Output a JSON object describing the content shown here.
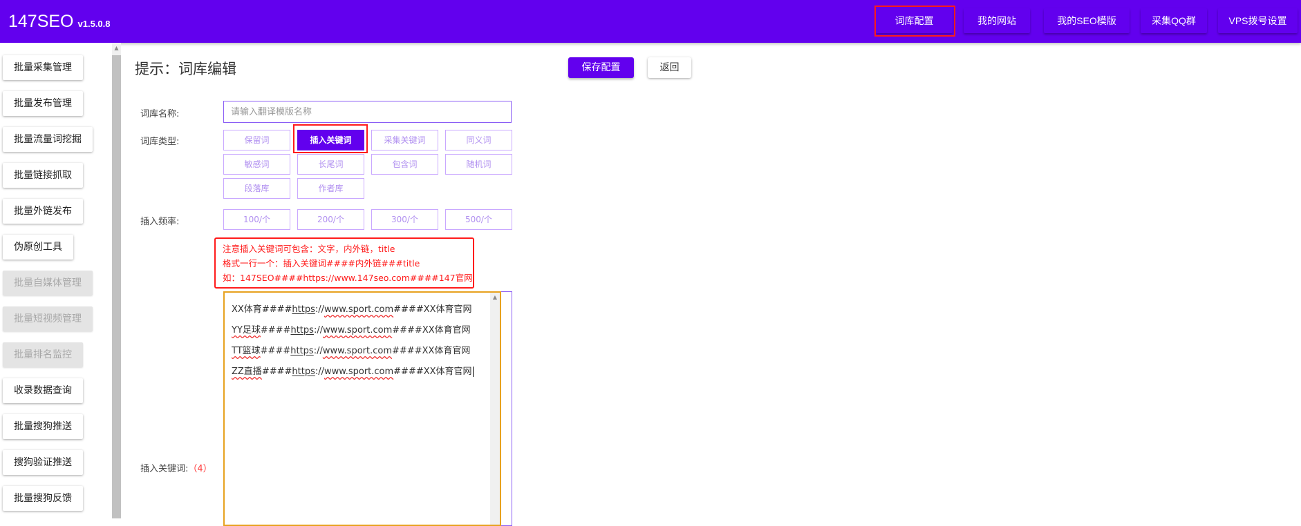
{
  "brand": {
    "name": "147SEO",
    "version": "v1.5.0.8"
  },
  "topnav": [
    {
      "label": "词库配置"
    },
    {
      "label": "我的网站"
    },
    {
      "label": "我的SEO模版"
    },
    {
      "label": "采集QQ群"
    },
    {
      "label": "VPS拨号设置"
    }
  ],
  "sidebar": [
    {
      "label": "批量采集管理",
      "disabled": false
    },
    {
      "label": "批量发布管理",
      "disabled": false
    },
    {
      "label": "批量流量词挖掘",
      "disabled": false
    },
    {
      "label": "批量链接抓取",
      "disabled": false
    },
    {
      "label": "批量外链发布",
      "disabled": false
    },
    {
      "label": "伪原创工具",
      "disabled": false
    },
    {
      "label": "批量自媒体管理",
      "disabled": true
    },
    {
      "label": "批量短视频管理",
      "disabled": true
    },
    {
      "label": "批量排名监控",
      "disabled": true
    },
    {
      "label": "收录数据查询",
      "disabled": false
    },
    {
      "label": "批量搜狗推送",
      "disabled": false
    },
    {
      "label": "搜狗验证推送",
      "disabled": false
    },
    {
      "label": "批量搜狗反馈",
      "disabled": false
    }
  ],
  "page": {
    "title": "提示：词库编辑",
    "save_label": "保存配置",
    "back_label": "返回"
  },
  "form": {
    "name_label": "词库名称:",
    "name_placeholder": "请输入翻译模版名称",
    "name_value": "",
    "type_label": "词库类型:",
    "types": [
      {
        "label": "保留词",
        "active": false
      },
      {
        "label": "插入关键词",
        "active": true
      },
      {
        "label": "采集关键词",
        "active": false
      },
      {
        "label": "同义词",
        "active": false
      },
      {
        "label": "敏感词",
        "active": false
      },
      {
        "label": "长尾词",
        "active": false
      },
      {
        "label": "包含词",
        "active": false
      },
      {
        "label": "随机词",
        "active": false
      },
      {
        "label": "段落库",
        "active": false
      },
      {
        "label": "作者库",
        "active": false
      }
    ],
    "freq_label": "插入频率:",
    "freqs": [
      "100/个",
      "200/个",
      "300/个",
      "500/个"
    ],
    "note": [
      "注意插入关键词可包含：文字，内外链，title",
      "格式一行一个：插入关键词####内外链###title",
      "如：147SEO####https://www.147seo.com####147官网"
    ],
    "keywords_label": "插入关键词:",
    "keywords_count": "（4）",
    "keywords": [
      {
        "name": "XX体育",
        "sep1": "####",
        "scheme": "https",
        "colon": "://",
        "domain": "www.sport.com",
        "sep2": "####",
        "title": "XX体育官网"
      },
      {
        "name": "YY足球",
        "sep1": "####",
        "scheme": "https",
        "colon": "://",
        "domain": "www.sport.com",
        "sep2": "####",
        "title": "XX体育官网"
      },
      {
        "name": "TT篮球",
        "sep1": "####",
        "scheme": "https",
        "colon": "://",
        "domain": "www.sport.com",
        "sep2": "####",
        "title": "XX体育官网"
      },
      {
        "name": "ZZ直播",
        "sep1": "####",
        "scheme": "https",
        "colon": "://",
        "domain": "www.sport.com",
        "sep2": "####",
        "title": "XX体育官网"
      }
    ]
  },
  "colors": {
    "accent": "#6200ee",
    "highlight": "#ff1a1a",
    "textarea_border": "#e7a21f"
  }
}
